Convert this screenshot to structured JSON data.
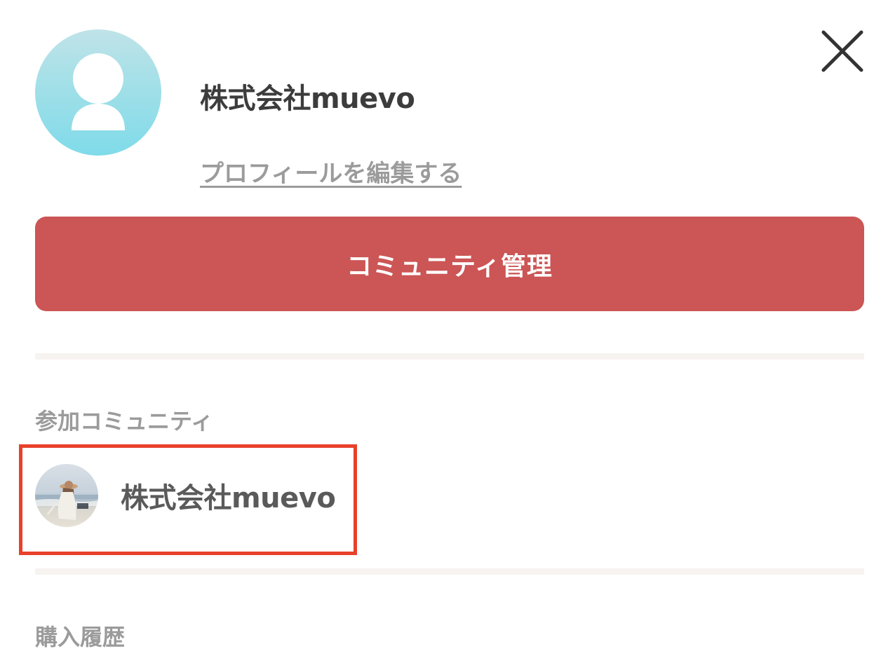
{
  "profile": {
    "name": "株式会社muevo",
    "edit_link": "プロフィールを編集する",
    "avatar_icon": "user-silhouette-icon"
  },
  "header": {
    "close_icon": "close-icon"
  },
  "community_manage_button": {
    "label": "コミュニティ管理",
    "color": "#cc5555"
  },
  "joined_communities": {
    "title": "参加コミュニティ",
    "items": [
      {
        "name": "株式会社muevo",
        "thumbnail": "beach-photo"
      }
    ]
  },
  "purchase_history": {
    "title": "購入履歴"
  },
  "colors": {
    "highlight_border": "#e8402a",
    "divider": "#f7f3f0"
  }
}
